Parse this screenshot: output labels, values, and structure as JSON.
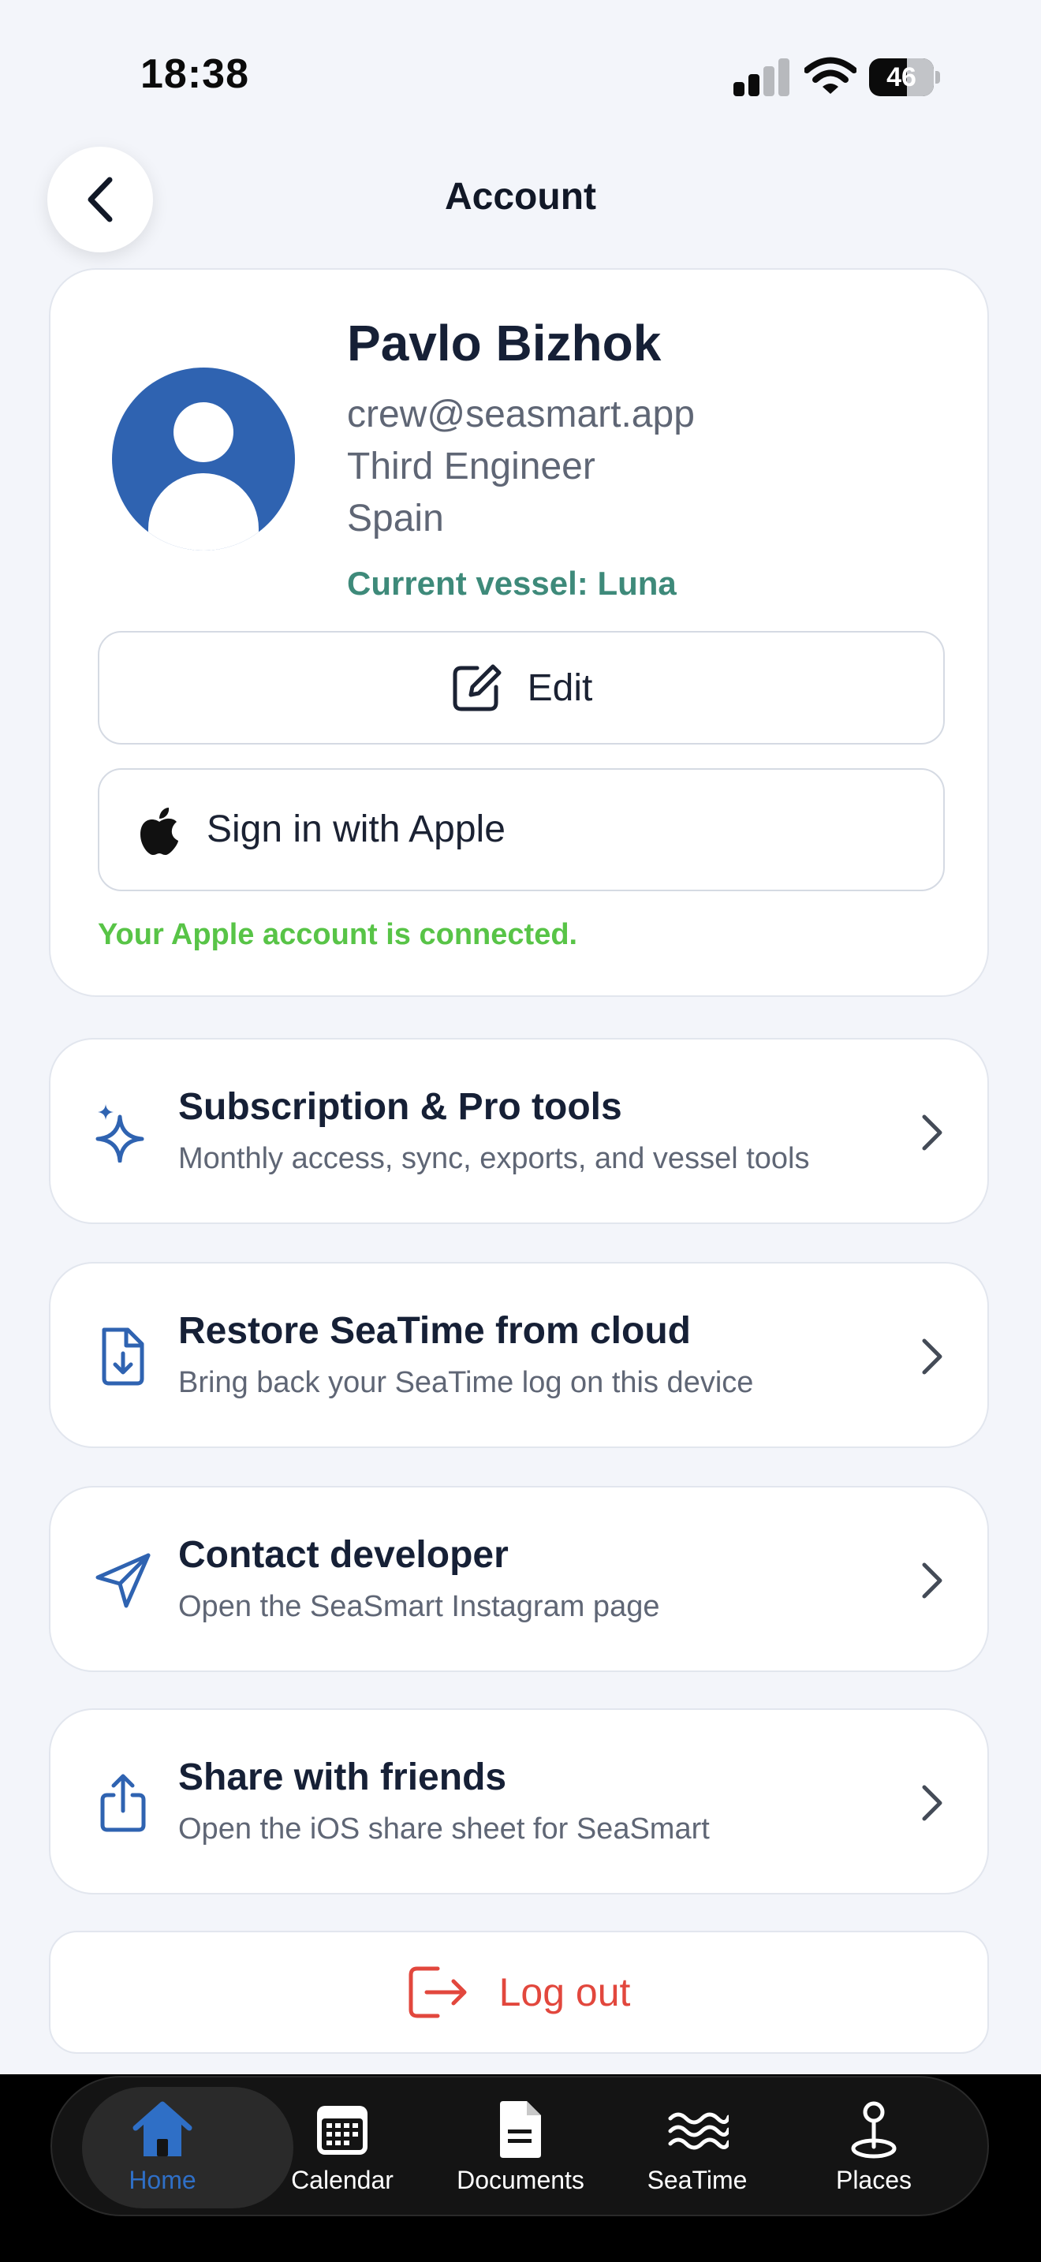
{
  "status_bar": {
    "time": "18:38",
    "battery": "46"
  },
  "header": {
    "title": "Account"
  },
  "profile": {
    "name": "Pavlo Bizhok",
    "email": "crew@seasmart.app",
    "rank": "Third Engineer",
    "country": "Spain",
    "vessel": "Current vessel: Luna",
    "edit_label": "Edit",
    "apple_label": "Sign in with Apple",
    "apple_status": "Your Apple account is connected."
  },
  "menu": [
    {
      "title": "Subscription & Pro tools",
      "subtitle": "Monthly access, sync, exports, and vessel tools",
      "icon": "sparkles-icon"
    },
    {
      "title": "Restore SeaTime from cloud",
      "subtitle": "Bring back your SeaTime log on this device",
      "icon": "document-download-icon"
    },
    {
      "title": "Contact developer",
      "subtitle": "Open the SeaSmart Instagram page",
      "icon": "paper-plane-icon"
    },
    {
      "title": "Share with friends",
      "subtitle": "Open the iOS share sheet for SeaSmart",
      "icon": "share-icon"
    }
  ],
  "logout": {
    "label": "Log out"
  },
  "tabs": [
    {
      "label": "Home",
      "icon": "home-icon",
      "active": true
    },
    {
      "label": "Calendar",
      "icon": "calendar-icon",
      "active": false
    },
    {
      "label": "Documents",
      "icon": "document-icon",
      "active": false
    },
    {
      "label": "SeaTime",
      "icon": "waves-icon",
      "active": false
    },
    {
      "label": "Places",
      "icon": "map-pin-icon",
      "active": false
    }
  ],
  "colors": {
    "accent": "#2f63b1",
    "vessel_text": "#3e8a7a",
    "connected_text": "#58c447",
    "logout": "#e2473d",
    "active_tab": "#2f6fc6"
  }
}
